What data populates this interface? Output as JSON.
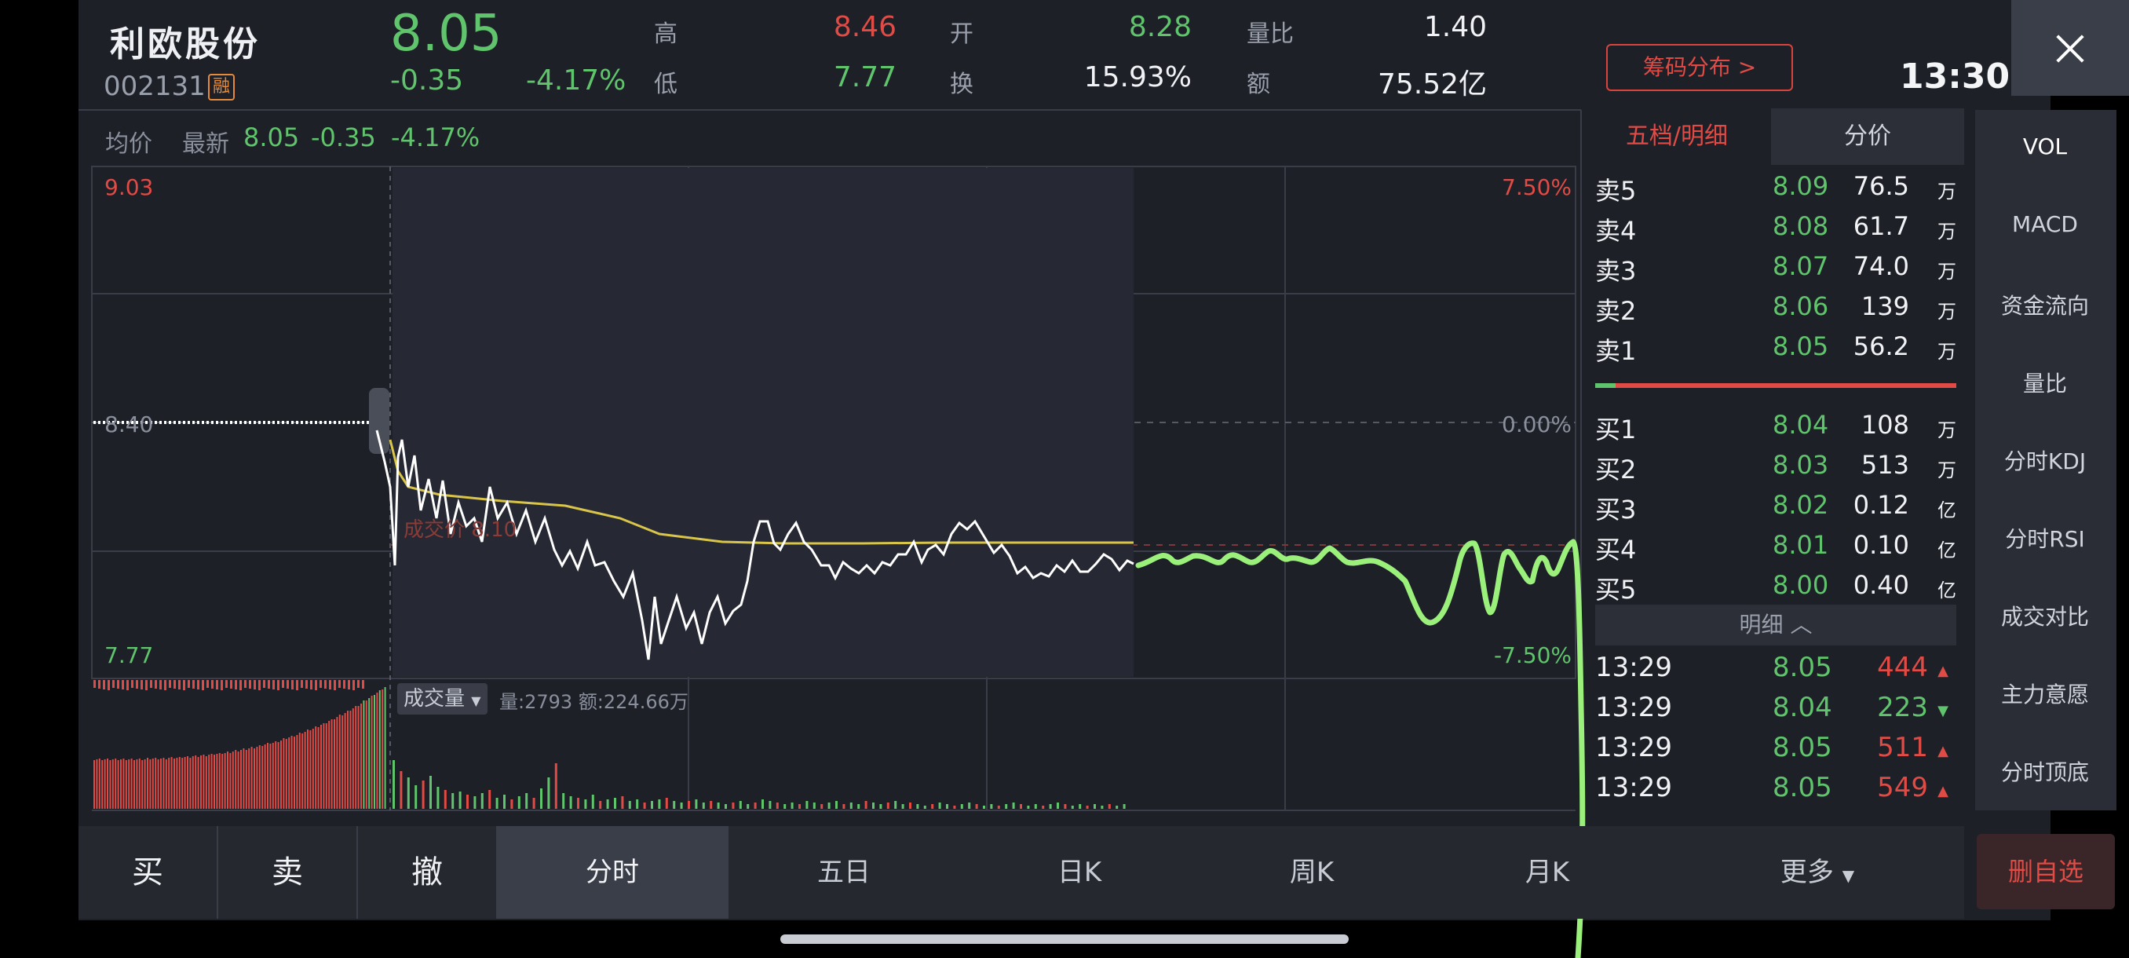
{
  "stock": {
    "name": "利欧股份",
    "code": "002131",
    "margin_badge": "融",
    "price": "8.05",
    "change": "-0.35",
    "change_pct": "-4.17%"
  },
  "quote": {
    "high_label": "高",
    "high": "8.46",
    "low_label": "低",
    "low": "7.77",
    "open_label": "开",
    "open": "8.28",
    "turnover_label": "换",
    "turnover": "15.93%",
    "vol_ratio_label": "量比",
    "vol_ratio": "1.40",
    "amount_label": "额",
    "amount": "75.52亿"
  },
  "chip_button": "筹码分布 >",
  "clock": "13:30",
  "legend": {
    "avg_label": "均价",
    "latest_label": "最新",
    "latest_price": "8.05",
    "latest_change": "-0.35",
    "latest_pct": "-4.17%"
  },
  "axis": {
    "top_price": "9.03",
    "mid_price": "8.40",
    "bottom_price": "7.77",
    "top_pct": "7.50%",
    "mid_pct": "0.00%",
    "bottom_pct": "-7.50%"
  },
  "deal_hint": "成交价 8.10",
  "volume": {
    "selector": "成交量",
    "vol_label": "量:2793",
    "amount_label": "额:224.66万"
  },
  "orderbook": {
    "tab_active": "五档/明细",
    "tab_inactive": "分价",
    "asks": [
      {
        "label": "卖5",
        "price": "8.09",
        "vol": "76.5",
        "unit": "万"
      },
      {
        "label": "卖4",
        "price": "8.08",
        "vol": "61.7",
        "unit": "万"
      },
      {
        "label": "卖3",
        "price": "8.07",
        "vol": "74.0",
        "unit": "万"
      },
      {
        "label": "卖2",
        "price": "8.06",
        "vol": "139",
        "unit": "万"
      },
      {
        "label": "卖1",
        "price": "8.05",
        "vol": "56.2",
        "unit": "万"
      }
    ],
    "bids": [
      {
        "label": "买1",
        "price": "8.04",
        "vol": "108",
        "unit": "万"
      },
      {
        "label": "买2",
        "price": "8.03",
        "vol": "513",
        "unit": "万"
      },
      {
        "label": "买3",
        "price": "8.02",
        "vol": "0.12",
        "unit": "亿"
      },
      {
        "label": "买4",
        "price": "8.01",
        "vol": "0.10",
        "unit": "亿"
      },
      {
        "label": "买5",
        "price": "8.00",
        "vol": "0.40",
        "unit": "亿"
      }
    ],
    "detail_toggle": "明细",
    "ticks": [
      {
        "time": "13:29",
        "price": "8.05",
        "vol": "444",
        "dir": "▲",
        "color": "#e04b45"
      },
      {
        "time": "13:29",
        "price": "8.04",
        "vol": "223",
        "dir": "▼",
        "color": "#5fc46b"
      },
      {
        "time": "13:29",
        "price": "8.05",
        "vol": "511",
        "dir": "▲",
        "color": "#e04b45"
      },
      {
        "time": "13:29",
        "price": "8.05",
        "vol": "549",
        "dir": "▲",
        "color": "#e04b45"
      }
    ]
  },
  "indicators": [
    "VOL",
    "MACD",
    "资金流向",
    "量比",
    "分时KDJ",
    "分时RSI",
    "成交对比",
    "主力意愿",
    "分时顶底"
  ],
  "tabs": {
    "buy": "买",
    "sell": "卖",
    "cancel": "撤",
    "intraday": "分时",
    "five_day": "五日",
    "daily": "日K",
    "weekly": "周K",
    "monthly": "月K",
    "more": "更多"
  },
  "remove_watch": "删自选",
  "colors": {
    "up": "#e04b45",
    "down": "#5fc46b",
    "avg_line": "#d9c54a",
    "price_line": "#ffffff",
    "annotation": "#9af07a",
    "background": "#1e2028"
  }
}
